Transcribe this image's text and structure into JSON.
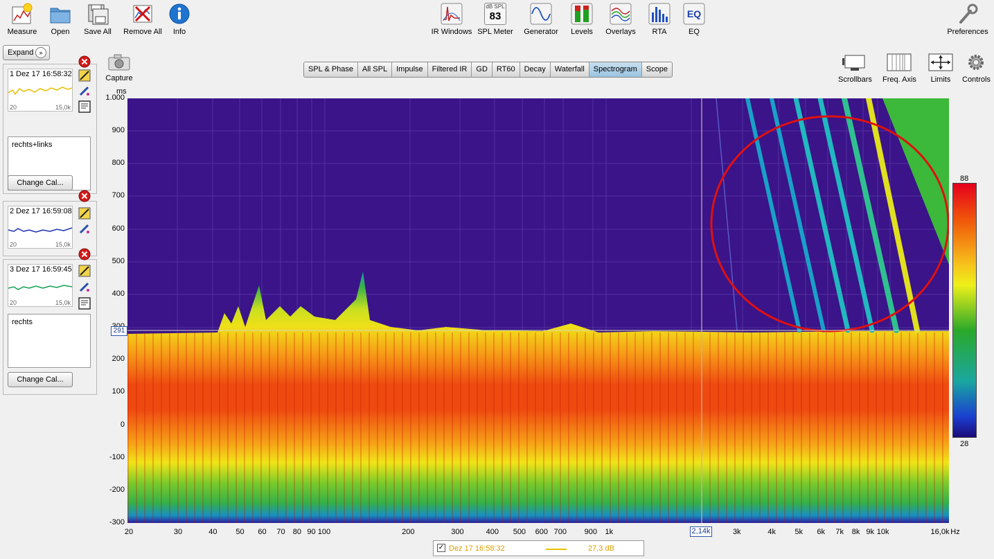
{
  "toolbar": {
    "left": [
      {
        "label": "Measure"
      },
      {
        "label": "Open"
      },
      {
        "label": "Save All"
      },
      {
        "label": "Remove All"
      },
      {
        "label": "Info"
      }
    ],
    "center": [
      {
        "label": "IR Windows"
      },
      {
        "label": "SPL Meter",
        "badge_top": "dB SPL",
        "badge_value": "83"
      },
      {
        "label": "Generator"
      },
      {
        "label": "Levels"
      },
      {
        "label": "Overlays"
      },
      {
        "label": "RTA"
      },
      {
        "label": "EQ"
      }
    ],
    "right": {
      "label": "Preferences"
    }
  },
  "panel": {
    "expand_label": "Expand",
    "measurements": [
      {
        "num": "1",
        "datetime": "Dez 17 16:58:32",
        "freq_lo": "20",
        "freq_hi": "15,0k",
        "note": "rechts+links",
        "cal_label": "Change Cal...",
        "color": "#e8c000"
      },
      {
        "num": "2",
        "datetime": "Dez 17 16:59:08",
        "freq_lo": "20",
        "freq_hi": "15,0k",
        "note": "",
        "cal_label": "",
        "color": "#1a2fb0"
      },
      {
        "num": "3",
        "datetime": "Dez 17 16:59:45",
        "freq_lo": "20",
        "freq_hi": "15,0k",
        "note": "rechts",
        "cal_label": "Change Cal...",
        "color": "#10a050"
      }
    ]
  },
  "capture_label": "Capture",
  "tabs": [
    "SPL & Phase",
    "All SPL",
    "Impulse",
    "Filtered IR",
    "GD",
    "RT60",
    "Decay",
    "Waterfall",
    "Spectrogram",
    "Scope"
  ],
  "active_tab": "Spectrogram",
  "right_controls": [
    "Scrollbars",
    "Freq. Axis",
    "Limits",
    "Controls"
  ],
  "plot": {
    "y_unit": "ms",
    "y_ticks": [
      "1.000",
      "900",
      "800",
      "700",
      "600",
      "500",
      "400",
      "300",
      "200",
      "100",
      "0",
      "-100",
      "-200",
      "-300"
    ],
    "x_ticks": [
      "20",
      "30",
      "40",
      "50",
      "60",
      "70",
      "80",
      "90",
      "100",
      "200",
      "300",
      "400",
      "500",
      "600",
      "700",
      "900",
      "1k",
      "3k",
      "4k",
      "5k",
      "6k",
      "7k",
      "8k",
      "9k",
      "10k",
      "16,0k",
      "Hz"
    ],
    "cursor_x": "2,14k",
    "cursor_y": "291",
    "colorbar_max": "88",
    "colorbar_min": "28"
  },
  "legend": {
    "datetime": "Dez 17 16:58:32",
    "value": "27,3 dB"
  }
}
